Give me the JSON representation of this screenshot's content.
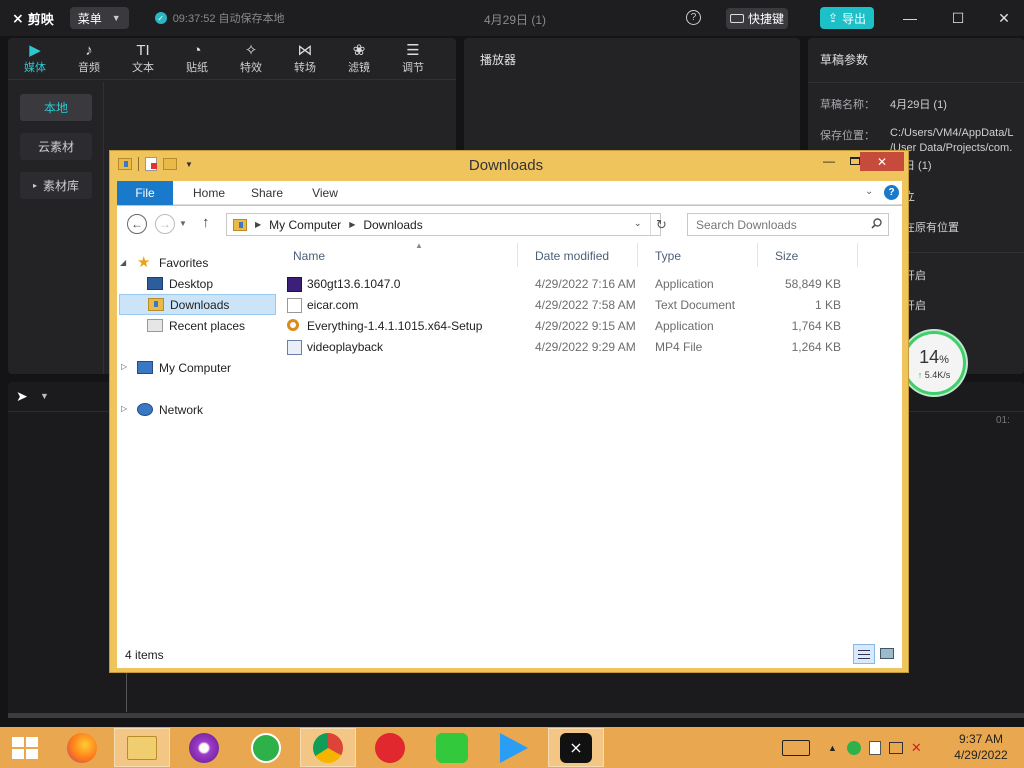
{
  "capcut": {
    "app_name": "剪映",
    "menu_label": "菜单",
    "autosave_text": "09:37:52 自动保存本地",
    "project_title": "4月29日 (1)",
    "shortcut_label": "快捷键",
    "export_label": "导出",
    "media_tabs": [
      {
        "icon": "▶",
        "label": "媒体"
      },
      {
        "icon": "♪",
        "label": "音频"
      },
      {
        "icon": "TI",
        "label": "文本"
      },
      {
        "icon": "◔",
        "label": "贴纸"
      },
      {
        "icon": "✧",
        "label": "特效"
      },
      {
        "icon": "⋈",
        "label": "转场"
      },
      {
        "icon": "❀",
        "label": "滤镜"
      },
      {
        "icon": "☰",
        "label": "调节"
      }
    ],
    "sidebar": [
      "本地",
      "云素材",
      "素材库"
    ],
    "player_title": "播放器",
    "draft_title": "草稿参数",
    "draft_name_label": "草稿名称：",
    "draft_name_value": "4月29日 (1)",
    "save_location_label": "保存位置：",
    "save_location_line1": "C:/Users/VM4/AppData/L",
    "save_location_line2": "/User Data/Projects/com.",
    "save_location_line3": "日 (1)",
    "partial_text_1": "立",
    "partial_text_2": "在原有位置",
    "partial_text_3": "开启",
    "partial_text_4": "开启",
    "timeline_time": "01:"
  },
  "speed_widget": {
    "percent": "14",
    "percent_unit": "%",
    "rate": "5.4K/s"
  },
  "explorer": {
    "window_title": "Downloads",
    "ribbon_tabs": [
      "File",
      "Home",
      "Share",
      "View"
    ],
    "breadcrumb": [
      "My Computer",
      "Downloads"
    ],
    "search_placeholder": "Search Downloads",
    "nav_tree": {
      "favorites": "Favorites",
      "desktop": "Desktop",
      "downloads": "Downloads",
      "recent": "Recent places",
      "computer": "My Computer",
      "network": "Network"
    },
    "columns": [
      "Name",
      "Date modified",
      "Type",
      "Size"
    ],
    "files": [
      {
        "name": "360gt13.6.1047.0",
        "date": "4/29/2022 7:16 AM",
        "type": "Application",
        "size": "58,849 KB",
        "icon": "app-360-icon"
      },
      {
        "name": "eicar.com",
        "date": "4/29/2022 7:58 AM",
        "type": "Text Document",
        "size": "1 KB",
        "icon": "text-file-icon"
      },
      {
        "name": "Everything-1.4.1.1015.x64-Setup",
        "date": "4/29/2022 9:15 AM",
        "type": "Application",
        "size": "1,764 KB",
        "icon": "everything-search-icon"
      },
      {
        "name": "videoplayback",
        "date": "4/29/2022 9:29 AM",
        "type": "MP4 File",
        "size": "1,264 KB",
        "icon": "mp4-file-icon"
      }
    ],
    "item_count": "4 items"
  },
  "taskbar": {
    "time": "9:37 AM",
    "date": "4/29/2022"
  }
}
